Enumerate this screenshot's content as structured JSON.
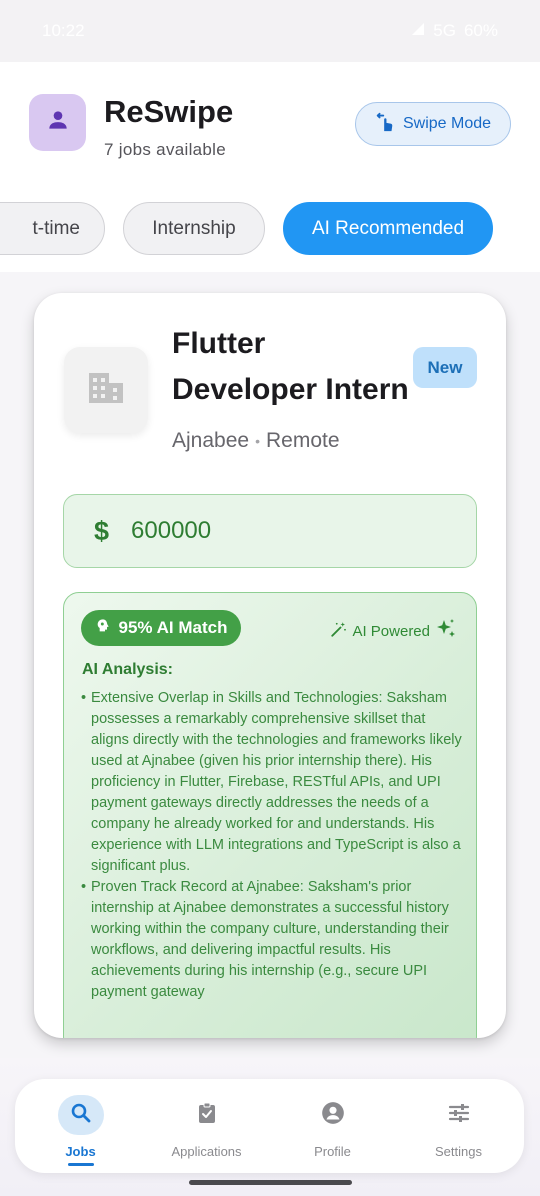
{
  "status_bar": {
    "time": "10:22",
    "network": "5G",
    "battery": "60%"
  },
  "header": {
    "app_title": "ReSwipe",
    "subtitle": "7 jobs available",
    "swipe_mode_label": "Swipe Mode",
    "icons": {
      "avatar": "person-icon",
      "swipe": "touch-swipe-icon"
    }
  },
  "filter_chips": [
    {
      "label": "t-time",
      "selected": false
    },
    {
      "label": "Internship",
      "selected": false
    },
    {
      "label": "AI Recommended",
      "selected": true
    }
  ],
  "job_card": {
    "title_line1": "Flutter",
    "title_line2": "Developer Intern",
    "badge": "New",
    "company": "Ajnabee",
    "location": "Remote",
    "salary_symbol": "$",
    "salary": "600000",
    "ai_match": "95% AI Match",
    "ai_powered": "AI Powered",
    "ai_analysis_label": "AI Analysis:",
    "ai_points": [
      "Extensive Overlap in Skills and Technologies: Saksham possesses a remarkably comprehensive skillset that aligns directly with the technologies and frameworks likely used at Ajnabee (given his prior internship there). His proficiency in Flutter, Firebase, RESTful APIs, and UPI payment gateways directly addresses the needs of a company he already worked for and understands. His experience with LLM integrations and TypeScript is also a significant plus.",
      "Proven Track Record at Ajnabee:  Saksham's prior internship at Ajnabee demonstrates a successful history working within the company culture, understanding their workflows, and delivering impactful results. His achievements during his internship (e.g., secure UPI payment gateway"
    ]
  },
  "bottom_nav": [
    {
      "label": "Jobs",
      "icon": "search-icon",
      "active": true
    },
    {
      "label": "Applications",
      "icon": "clipboard-check-icon",
      "active": false
    },
    {
      "label": "Profile",
      "icon": "account-circle-icon",
      "active": false
    },
    {
      "label": "Settings",
      "icon": "tune-sliders-icon",
      "active": false
    }
  ],
  "colors": {
    "primary": "#2196f3",
    "success": "#43a047",
    "avatar_bg": "#d9c8f1",
    "badge_bg": "#bfe0fb"
  }
}
